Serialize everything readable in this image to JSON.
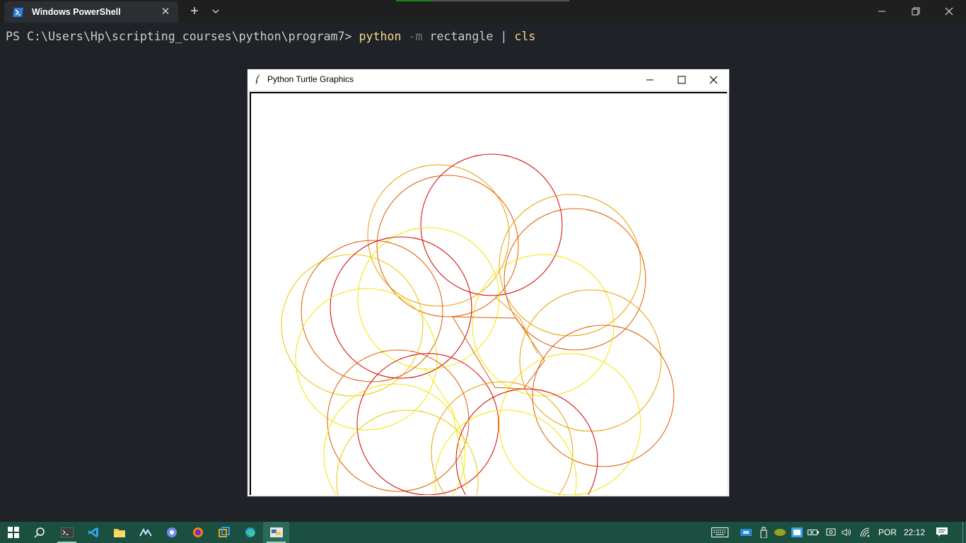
{
  "terminal": {
    "tab_title": "Windows PowerShell",
    "tab_close": "✕",
    "new_tab": "+",
    "prompt": "PS C:\\Users\\Hp\\scripting_courses\\python\\program7> ",
    "command": "python",
    "flag": "-m",
    "argument": "rectangle",
    "pipe": "|",
    "command2": "cls"
  },
  "turtle_window": {
    "title": "Python Turtle Graphics"
  },
  "canvas": {
    "drawing": "overlapping circles in red, orange and yellow"
  },
  "taskbar": {
    "language": "POR",
    "time": "22:12"
  },
  "colors": {
    "terminal_bg": "#1f2226",
    "taskbar_bg": "#1b4f3f",
    "circle_red": "#d40000",
    "circle_orange": "#e58a00",
    "circle_yellow": "#f2e600"
  }
}
